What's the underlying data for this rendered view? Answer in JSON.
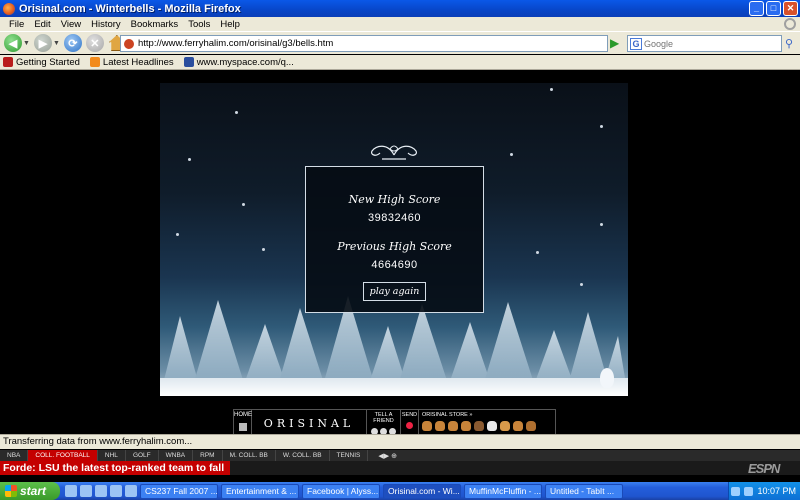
{
  "window": {
    "title": "Orisinal.com - Winterbells - Mozilla Firefox",
    "buttons": [
      "_",
      "□",
      "✕"
    ]
  },
  "menu": [
    "File",
    "Edit",
    "View",
    "History",
    "Bookmarks",
    "Tools",
    "Help"
  ],
  "address": {
    "url": "http://www.ferryhalim.com/orisinal/g3/bells.htm"
  },
  "search": {
    "placeholder": "Google"
  },
  "bookmarks": [
    "Getting Started",
    "Latest Headlines",
    "www.myspace.com/q..."
  ],
  "game": {
    "new_high_label": "New High Score",
    "new_high_value": "39832460",
    "prev_high_label": "Previous High Score",
    "prev_high_value": "4664690",
    "play_again": "play again"
  },
  "orisinal": {
    "home": "HOME",
    "logo": "ORISINAL",
    "tell": "TELL A FRIEND",
    "send": "SEND",
    "store": "ORISINAL STORE »"
  },
  "status": "Transferring data from www.ferryhalim.com...",
  "ticker": {
    "tabs": [
      "NBA",
      "COLL. FOOTBALL",
      "NHL",
      "GOLF",
      "WNBA",
      "RPM",
      "M. COLL. BB",
      "W. COLL. BB",
      "TENNIS"
    ],
    "headline": "Forde: LSU the latest top-ranked team to fall",
    "logo": "ESPN"
  },
  "taskbar": {
    "start": "start",
    "tasks": [
      "CS237 Fall 2007 ...",
      "Entertainment & ...",
      "Facebook | Alyss...",
      "Orisinal.com - Wi...",
      "MuffinMcFluffin - ...",
      "Untitled - TabIt ..."
    ],
    "clock": "10:07 PM"
  }
}
